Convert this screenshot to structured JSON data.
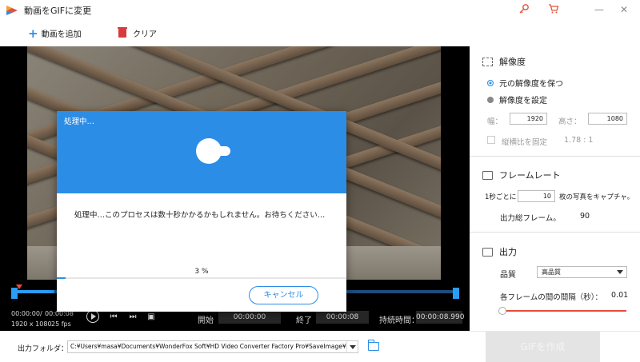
{
  "window": {
    "title": "動画をGIFに変更",
    "icons": [
      "key-icon",
      "cart-icon"
    ],
    "controls": [
      "minimize",
      "close"
    ]
  },
  "toolbar": {
    "add_video_label": "動画を追加",
    "clear_label": "クリア"
  },
  "timeline": {
    "current_time": "00:00:00",
    "total_time": "00:00:08",
    "resolution": "1920 x 1080",
    "fps": "25 fps",
    "start_label": "開始",
    "start_value": "00:00:00",
    "end_label": "終了",
    "end_value": "00:00:08",
    "duration_label": "持続時間：",
    "duration_value": "00:00:08.990",
    "progress_fraction": 0.09
  },
  "output": {
    "folder_label": "出力フォルダ：",
    "folder_path": "C:¥Users¥masa¥Documents¥WonderFox Soft¥HD Video Converter Factory Pro¥SaveImage¥",
    "make_gif_label": "GIFを作成"
  },
  "panel": {
    "resolution": {
      "title": "解像度",
      "keep_original": "元の解像度を保つ",
      "set_resolution": "解像度を設定",
      "width_label": "幅：",
      "width_value": "1920",
      "height_label": "高さ：",
      "height_value": "1080",
      "fix_ratio_label": "縦横比を固定",
      "ratio_value": "1.78 : 1"
    },
    "framerate": {
      "title": "フレームレート",
      "per_second_prefix": "1秒ごとに",
      "per_second_value": "10",
      "per_second_suffix": "枚の写真をキャプチャ。",
      "total_frames_label": "出力総フレーム。",
      "total_frames_value": "90"
    },
    "output": {
      "title": "出力",
      "quality_label": "品質",
      "quality_value": "高品質",
      "interval_label": "各フレームの間の間隔（秒）：",
      "interval_value": "0.01"
    }
  },
  "modal": {
    "title": "処理中…",
    "message": "処理中…このプロセスは数十秒かかるかもしれません。お待ちください…",
    "percent_text": "3 %",
    "progress_fraction": 0.03,
    "cancel_label": "キャンセル"
  }
}
